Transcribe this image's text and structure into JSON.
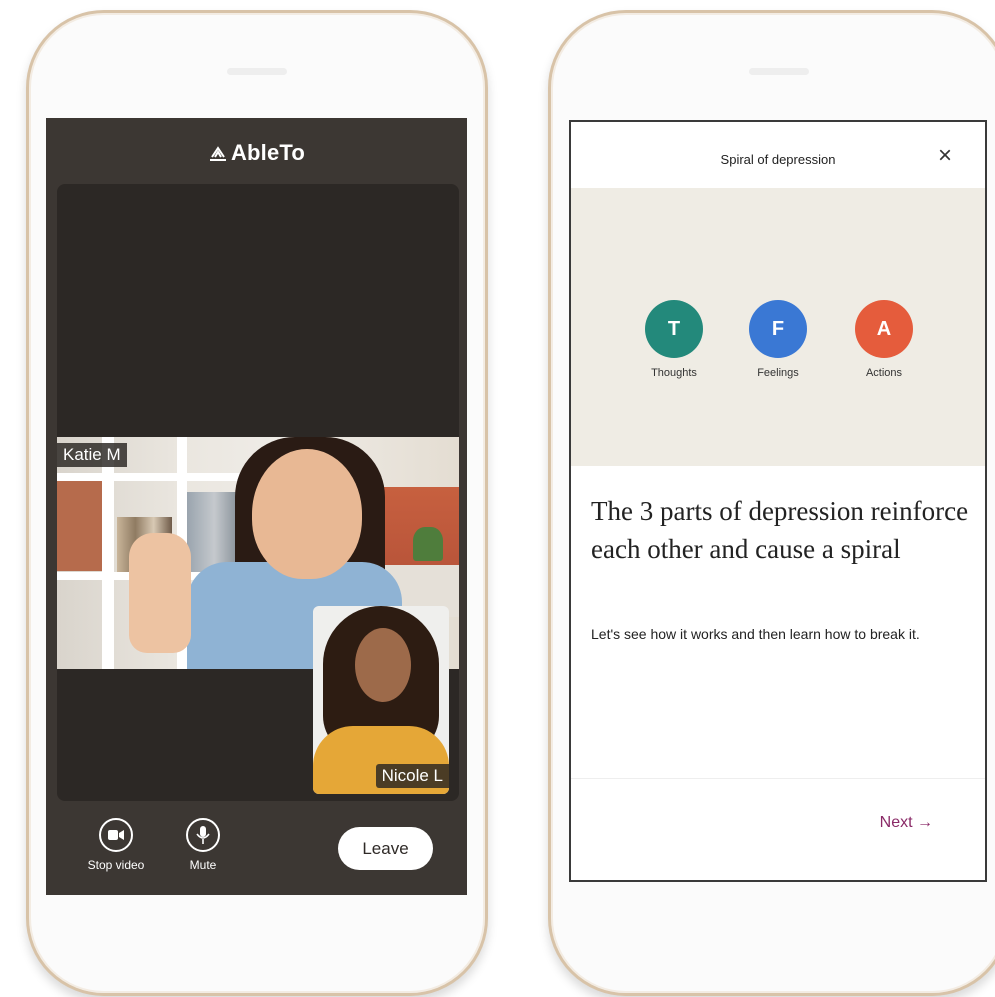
{
  "left_phone": {
    "brand": "AbleTo",
    "participants": {
      "main": "Katie M",
      "pip": "Nicole L"
    },
    "controls": {
      "stop_video": "Stop video",
      "mute": "Mute",
      "leave": "Leave"
    }
  },
  "right_phone": {
    "modal_title": "Spiral of depression",
    "close_symbol": "×",
    "parts": [
      {
        "letter": "T",
        "label": "Thoughts",
        "color": "#23897b"
      },
      {
        "letter": "F",
        "label": "Feelings",
        "color": "#3a78d4"
      },
      {
        "letter": "A",
        "label": "Actions",
        "color": "#e55c3c"
      }
    ],
    "headline": "The 3 parts of depression reinforce each other and cause a spiral",
    "body": "Let's see how it works and then learn how to break it.",
    "next_label": "Next →"
  }
}
